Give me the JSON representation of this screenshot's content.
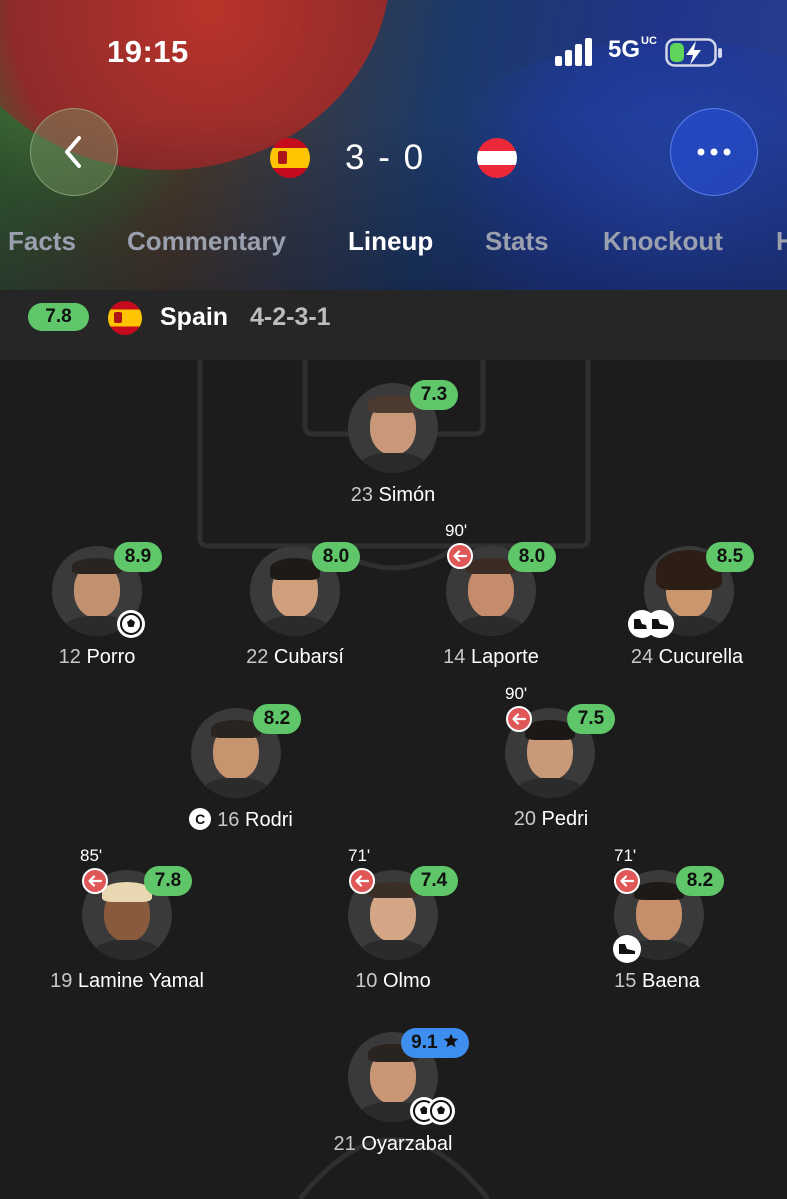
{
  "status_bar": {
    "time": "19:15",
    "network": "5G",
    "network_suffix": "UC",
    "signal_icon": "cellular-signal-icon",
    "battery_icon": "battery-charging-icon"
  },
  "match": {
    "home_flag": "spain-flag-icon",
    "away_flag": "austria-flag-icon",
    "score": "3 - 0"
  },
  "tabs": [
    {
      "label": "Facts"
    },
    {
      "label": "Commentary"
    },
    {
      "label": "Lineup"
    },
    {
      "label": "Stats"
    },
    {
      "label": "Knockout"
    },
    {
      "label": "H"
    }
  ],
  "active_tab": "Lineup",
  "team": {
    "rating": "7.8",
    "name": "Spain",
    "formation": "4-2-3-1"
  },
  "players": [
    {
      "number": "23",
      "name": "Simón",
      "rating": "7.3"
    },
    {
      "number": "12",
      "name": "Porro",
      "rating": "8.9"
    },
    {
      "number": "22",
      "name": "Cubarsí",
      "rating": "8.0"
    },
    {
      "number": "14",
      "name": "Laporte",
      "rating": "8.0",
      "sub_time": "90'"
    },
    {
      "number": "24",
      "name": "Cucurella",
      "rating": "8.5"
    },
    {
      "number": "16",
      "name": "Rodri",
      "rating": "8.2",
      "captain": "C"
    },
    {
      "number": "20",
      "name": "Pedri",
      "rating": "7.5",
      "sub_time": "90'"
    },
    {
      "number": "19",
      "name": "Lamine Yamal",
      "rating": "7.8",
      "sub_time": "85'"
    },
    {
      "number": "10",
      "name": "Olmo",
      "rating": "7.4",
      "sub_time": "71'"
    },
    {
      "number": "15",
      "name": "Baena",
      "rating": "8.2",
      "sub_time": "71'"
    },
    {
      "number": "21",
      "name": "Oyarzabal",
      "rating": "9.1"
    }
  ],
  "colors": {
    "rating_green": "#5fc76a",
    "rating_blue": "#3e8ef0",
    "sub_red": "#e05757",
    "background": "#1c1c1c"
  }
}
